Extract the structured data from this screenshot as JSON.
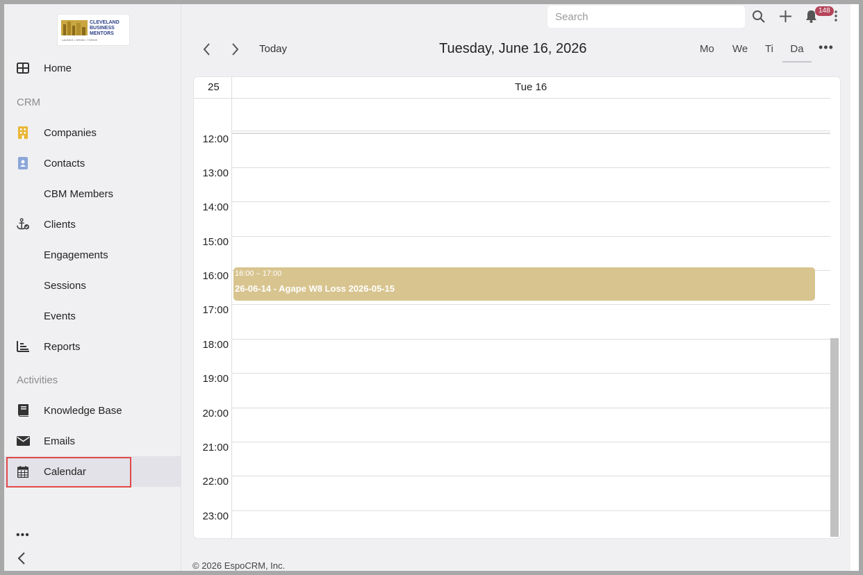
{
  "logo": {
    "line1": "CLEVELAND",
    "line2": "BUSINESS",
    "line3": "MENTORS",
    "tagline": "LAUNCH • GROW • THRIVE"
  },
  "sidebar": {
    "items": [
      {
        "label": "Home",
        "icon": "home-grid-icon"
      },
      {
        "label": "Companies",
        "icon": "building-icon",
        "color": "#e8b637"
      },
      {
        "label": "Contacts",
        "icon": "contact-card-icon",
        "color": "#8ba6d8"
      },
      {
        "label": "CBM Members"
      },
      {
        "label": "Clients",
        "icon": "anchor-check-icon"
      },
      {
        "label": "Engagements"
      },
      {
        "label": "Sessions"
      },
      {
        "label": "Events"
      },
      {
        "label": "Reports",
        "icon": "bar-chart-icon"
      },
      {
        "label": "Knowledge Base",
        "icon": "book-icon"
      },
      {
        "label": "Emails",
        "icon": "envelope-icon"
      },
      {
        "label": "Calendar",
        "icon": "calendar-icon",
        "active": true
      }
    ],
    "sections": {
      "crm": "CRM",
      "activities": "Activities"
    },
    "more": "•••"
  },
  "topbar": {
    "search_placeholder": "Search",
    "notification_count": "148"
  },
  "calendar": {
    "today_label": "Today",
    "title": "Tuesday, June 16, 2026",
    "views": [
      "Mo",
      "We",
      "Ti",
      "Da"
    ],
    "active_view": "Da",
    "view_more": "•••",
    "week_number": "25",
    "day_header": "Tue 16",
    "hours": [
      "12:00",
      "13:00",
      "14:00",
      "15:00",
      "16:00",
      "17:00",
      "18:00",
      "19:00",
      "20:00",
      "21:00",
      "22:00",
      "23:00"
    ],
    "event": {
      "time": "16:00 – 17:00",
      "title": "26-06-14 - Agape W8 Loss 2026-05-15",
      "color": "#d8c48f"
    }
  },
  "footer": "© 2026 EspoCRM, Inc."
}
